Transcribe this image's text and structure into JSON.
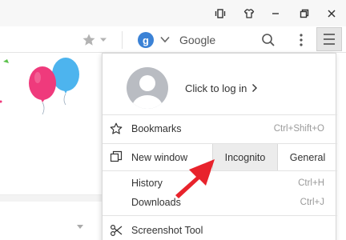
{
  "toolbar": {
    "search_engine_letter": "g",
    "search_engine_name": "Google"
  },
  "menu": {
    "login_label": "Click to log in",
    "items": [
      {
        "label": "Bookmarks",
        "shortcut": "Ctrl+Shift+O",
        "icon": "star-outline-icon"
      },
      {
        "label": "New window",
        "icon": "new-window-icon"
      },
      {
        "label": "History",
        "shortcut": "Ctrl+H"
      },
      {
        "label": "Downloads",
        "shortcut": "Ctrl+J"
      },
      {
        "label": "Screenshot Tool",
        "icon": "scissors-icon"
      }
    ],
    "new_window_options": [
      "Incognito",
      "General"
    ]
  },
  "colors": {
    "annotation_arrow": "#e8232c",
    "engine_badge": "#3b82d6",
    "balloon_pink": "#ef3a7c",
    "balloon_blue": "#4db4ee"
  }
}
